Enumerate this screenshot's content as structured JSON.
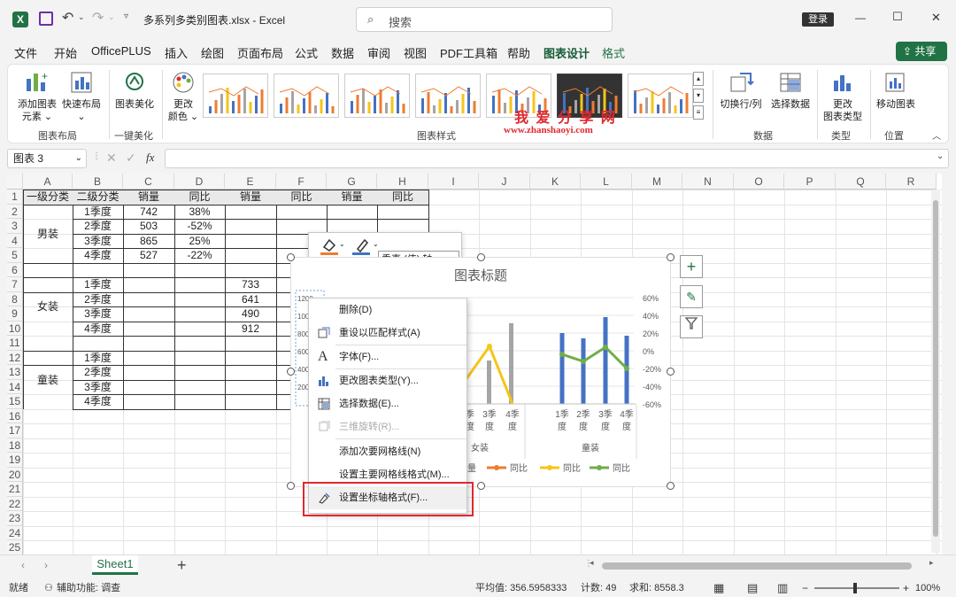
{
  "titlebar": {
    "filename": "多系列多类别图表.xlsx",
    "app": "Excel",
    "search_placeholder": "搜索",
    "login": "登录",
    "minimize": "—",
    "maximize": "☐",
    "close": "✕"
  },
  "menu": {
    "items": [
      "文件",
      "开始",
      "OfficePLUS",
      "插入",
      "绘图",
      "页面布局",
      "公式",
      "数据",
      "审阅",
      "视图",
      "PDF工具箱",
      "帮助",
      "图表设计",
      "格式"
    ],
    "active": "图表设计",
    "share": "共享"
  },
  "ribbon": {
    "add_element": "添加图表",
    "add_element2": "元素",
    "quick_layout": "快速布局",
    "beautify": "图表美化",
    "change_color": "更改",
    "change_color2": "颜色",
    "switch_row_col": "切换行/列",
    "select_data": "选择数据",
    "change_type": "更改",
    "change_type2": "图表类型",
    "move_chart": "移动图表",
    "groups": {
      "layout": "图表布局",
      "beautify": "一键美化",
      "styles": "图表样式",
      "data": "数据",
      "type": "类型",
      "location": "位置"
    },
    "watermark_cn": "我 爱 分 享 网",
    "watermark_url": "www.zhanshaoyi.com"
  },
  "formula": {
    "namebox": "图表 3",
    "fx": "fx",
    "value": ""
  },
  "columns": [
    "A",
    "B",
    "C",
    "D",
    "E",
    "F",
    "G",
    "H",
    "I",
    "J",
    "K",
    "L",
    "M",
    "N",
    "O",
    "P",
    "Q",
    "R"
  ],
  "rows": [
    "1",
    "2",
    "3",
    "4",
    "5",
    "6",
    "7",
    "8",
    "9",
    "10",
    "11",
    "12",
    "13",
    "14",
    "15",
    "16",
    "17",
    "18",
    "19",
    "20",
    "21",
    "22",
    "23",
    "24",
    "25"
  ],
  "table": {
    "headers": [
      "一级分类",
      "二级分类",
      "销量",
      "同比",
      "销量",
      "同比",
      "销量",
      "同比"
    ],
    "groups": [
      "男装",
      "女装",
      "童装"
    ],
    "quarters": [
      "1季度",
      "2季度",
      "3季度",
      "4季度"
    ],
    "men_sales": [
      "742",
      "503",
      "865",
      "527"
    ],
    "men_yoy": [
      "38%",
      "-52%",
      "25%",
      "-22%"
    ],
    "women_sales": [
      "733",
      "641",
      "490",
      "912"
    ]
  },
  "mini_toolbar": {
    "fill": "填充",
    "border": "边框",
    "selector": "垂直 (值) 轴"
  },
  "chart": {
    "title": "图表标题",
    "left_ticks": [
      "1200",
      "1000",
      "800",
      "600",
      "400",
      "200"
    ],
    "right_ticks": [
      "60%",
      "40%",
      "20%",
      "0%",
      "-20%",
      "-40%",
      "-60%"
    ],
    "x_labels_visible": [
      "季",
      "度",
      "3季",
      "度",
      "4季",
      "度"
    ],
    "kid_labels": [
      "1季度",
      "2季度",
      "3季度",
      "4季度"
    ],
    "group_women": "女装",
    "group_kids": "童装",
    "legend": [
      "量",
      "同比",
      "同比",
      "同比"
    ]
  },
  "chart_data": {
    "type": "bar",
    "categories": [
      "1季度",
      "2季度",
      "3季度",
      "4季度"
    ],
    "kids_sales_estimate": [
      800,
      740,
      980,
      770
    ],
    "kids_yoy_estimate": [
      -4,
      -12,
      4,
      -20
    ],
    "women_yoy_estimate": [
      null,
      -40,
      5,
      -60
    ],
    "women_sales_estimate": [
      null,
      null,
      490,
      912
    ],
    "left_ylim": [
      0,
      1200
    ],
    "right_ylim": [
      -60,
      60
    ]
  },
  "context_menu": {
    "items": [
      "删除(D)",
      "重设以匹配样式(A)",
      "字体(F)...",
      "更改图表类型(Y)...",
      "选择数据(E)...",
      "三维旋转(R)...",
      "添加次要网格线(N)",
      "设置主要网格线格式(M)...",
      "设置坐标轴格式(F)..."
    ]
  },
  "sheet": {
    "tab": "Sheet1"
  },
  "status": {
    "ready": "就绪",
    "accessibility": "辅助功能: 调查",
    "average": "平均值: 356.5958333",
    "count": "计数: 49",
    "sum": "求和: 8558.3",
    "zoom": "100%"
  },
  "colors": {
    "excel_green": "#217346",
    "bar_blue": "#4472c4",
    "line_orange": "#ed7d31",
    "line_yellow": "#f5c518",
    "line_green": "#70ad47",
    "highlight_red": "#e0282e"
  }
}
